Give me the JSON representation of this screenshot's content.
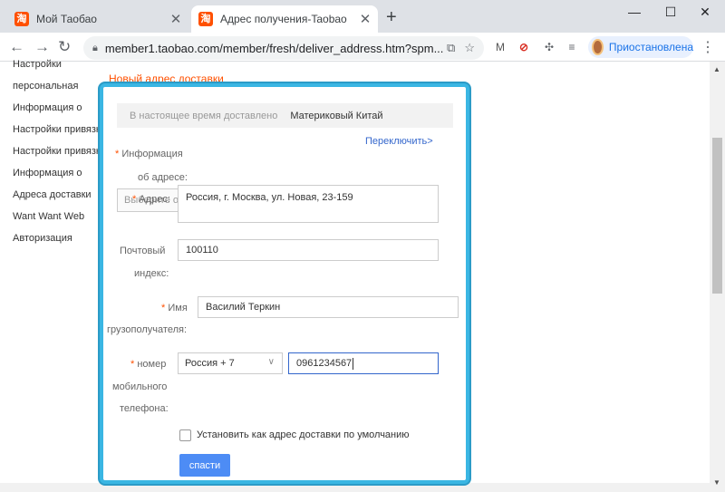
{
  "browser": {
    "tabs": [
      {
        "favicon": "淘",
        "title": "Мой Таобао",
        "close": "✕"
      },
      {
        "favicon": "淘",
        "title": "Адрес получения-Taobao",
        "close": "✕"
      }
    ],
    "new_tab": "+",
    "window_controls": {
      "minimize": "—",
      "maximize": "☐",
      "close": "✕"
    },
    "url": "member1.taobao.com/member/fresh/deliver_address.htm?spm...",
    "profile_label": "Приостановлена"
  },
  "sidebar": {
    "items": [
      "Настройки",
      "персональная",
      "Информация о",
      "Настройки привязки",
      "Настройки привязки",
      "Информация о",
      "Адреса доставки",
      "Want Want Web",
      "Авторизация"
    ]
  },
  "page": {
    "heading_link": "Новый адрес доставки"
  },
  "form": {
    "delivered_label": "В настоящее время доставлено",
    "delivered_value": "Материковый Китай",
    "switch_link": "Переключить>",
    "info_label_1": "Информация",
    "info_label_2": "об адресе:",
    "address_select_text": "Выберите о",
    "address_label": "Адрес:",
    "address_value": "Россия, г. Москва, ул. Новая, 23-159",
    "postal_label_1": "Почтовый",
    "postal_label_2": "индекс:",
    "postal_value": "100110",
    "name_label_1": "Имя",
    "name_label_2": "грузополучателя:",
    "name_value": "Василий Теркин",
    "phone_label_1": "номер",
    "phone_label_2": "мобильного",
    "phone_label_3": "телефона:",
    "phone_country": "Россия + 7",
    "phone_value": "0961234567",
    "default_checkbox_label": "Установить как адрес доставки по умолчанию",
    "default_checked": false,
    "save_label": "спасти",
    "required_mark": "*"
  }
}
